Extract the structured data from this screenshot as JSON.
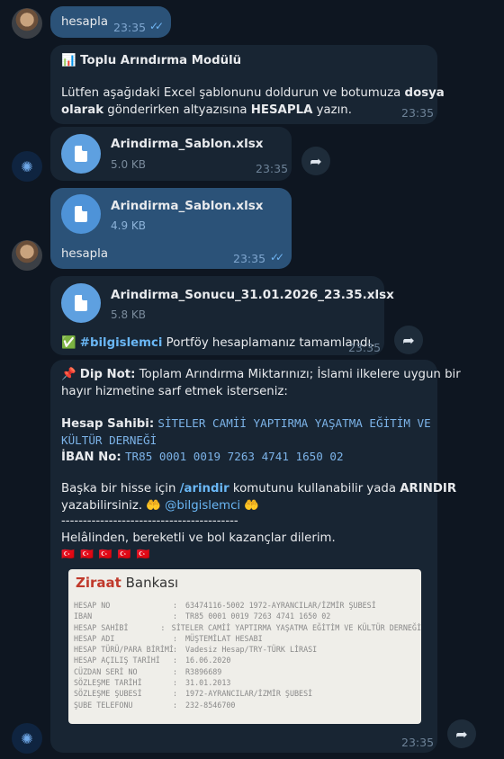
{
  "colors": {
    "bg": "#0e1621",
    "incoming": "#182533",
    "outgoing": "#2b5278",
    "link": "#6ab7f5",
    "accent": "#5ea0e0"
  },
  "msg1": {
    "text": "hesapla",
    "time": "23:35"
  },
  "msg2": {
    "title": "📊 Toplu Arındırma Modülü",
    "line1_a": "Lütfen aşağıdaki Excel şablonunu doldurun ve botumuza ",
    "line1_b": "dosya",
    "line2_a": "olarak",
    "line2_b": " gönderirken altyazısına ",
    "line2_c": "HESAPLA",
    "line2_d": " yazın.",
    "time": "23:35"
  },
  "msg3": {
    "file_name": "Arindirma_Sablon.xlsx",
    "file_size": "5.0 KB",
    "time": "23:35"
  },
  "msg4": {
    "file_name": "Arindirma_Sablon.xlsx",
    "file_size": "4.9 KB",
    "caption": "hesapla",
    "time": "23:35"
  },
  "msg5": {
    "file_name": "Arindirma_Sonucu_31.01.2026_23.35.xlsx",
    "file_size": "5.8 KB",
    "check": "✅",
    "hashtag": "#bilgislemci",
    "caption": " Portföy hesaplamanız tamamlandı.",
    "time": "23:35"
  },
  "msg6": {
    "pin": "📌",
    "label": "Dip Not:",
    "line1": " Toplam Arındırma Miktarınızı; İslami ilkelere uygun bir",
    "line2": "hayır hizmetine sarf etmek isterseniz:",
    "holder_label": "Hesap Sahibi:",
    "holder_1": "SİTELER CAMİİ YAPTIRMA YAŞATMA EĞİTİM VE",
    "holder_2": "KÜLTÜR DERNEĞİ",
    "iban_label": "İBAN No:",
    "iban": "TR85 0001 0019 7263 4741 1650 02",
    "share_a": "Başka bir hisse için ",
    "share_cmd": "/arindir",
    "share_b": " komutunu kullanabilir yada ",
    "share_c": "ARINDIR",
    "share_d": "yazabilirsiniz. ",
    "hands1": "🤲",
    "mention": "@bilgislemci",
    "hands2": "🤲",
    "divider": "-----------------------------------------",
    "blessing": "Helâlinden, bereketli ve bol kazançlar dilerim.",
    "flags": "🇹🇷🇹🇷🇹🇷🇹🇷🇹🇷",
    "time": "23:35"
  },
  "bank_card": {
    "logo_a": "Ziraat",
    "logo_b": " Bankası",
    "rows": [
      {
        "k": "HESAP NO",
        "v": "63474116-5002      1972-AYRANCILAR/İZMİR ŞUBESİ"
      },
      {
        "k": "IBAN",
        "v": "TR85 0001 0019 7263 4741 1650 02"
      },
      {
        "k": "HESAP SAHİBİ",
        "v": "SİTELER CAMİİ YAPTIRMA YAŞATMA EĞİTİM VE KÜLTÜR DERNEĞİ"
      },
      {
        "k": "HESAP ADI",
        "v": "MÜŞTEMİLAT HESABI"
      },
      {
        "k": "HESAP TÜRÜ/PARA BİRİMİ",
        "v": "Vadesiz Hesap/TRY-TÜRK LİRASI"
      },
      {
        "k": "HESAP AÇILIŞ TARİHİ",
        "v": "16.06.2020"
      },
      {
        "k": "CÜZDAN SERİ NO",
        "v": "R3896689"
      },
      {
        "k": "SÖZLEŞME TARİHİ",
        "v": "31.01.2013"
      },
      {
        "k": "SÖZLEŞME ŞUBESİ",
        "v": "1972-AYRANCILAR/İZMİR ŞUBESİ"
      },
      {
        "k": "ŞUBE TELEFONU",
        "v": "232-8546700"
      }
    ]
  }
}
